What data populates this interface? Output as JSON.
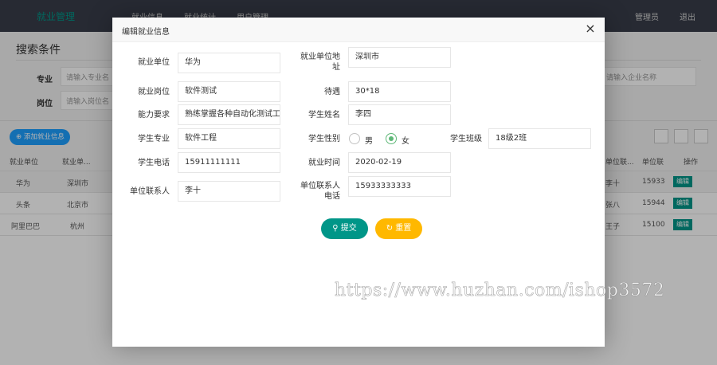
{
  "topbar": {
    "logo": "就业管理",
    "nav": [
      "就业信息",
      "就业统计",
      "用户管理"
    ],
    "admin": "管理员",
    "logout": "退出"
  },
  "search": {
    "title": "搜索条件",
    "major_label": "专业",
    "major_placeholder": "请输入专业名",
    "post_label": "岗位",
    "post_placeholder": "请输入岗位名",
    "company_placeholder": "请输入企业名称"
  },
  "toolbar": {
    "add_label": "添加就业信息"
  },
  "table": {
    "headers_left": [
      "就业单位",
      "就业单..."
    ],
    "headers_right": [
      "单位联...",
      "单位联",
      "操作"
    ],
    "rows": [
      {
        "company": "华为",
        "address": "深圳市",
        "contact": "李十",
        "phone": "15933",
        "action": "编辑"
      },
      {
        "company": "头条",
        "address": "北京市",
        "contact": "张八",
        "phone": "15944",
        "action": "编辑"
      },
      {
        "company": "阿里巴巴",
        "address": "杭州",
        "contact": "王子",
        "phone": "15100",
        "action": "编辑"
      }
    ]
  },
  "dialog": {
    "title": "编辑就业信息",
    "close_icon": "×",
    "fields": {
      "company_label": "就业单位",
      "company_value": "华为",
      "address_label": "就业单位地址",
      "address_value": "深圳市",
      "post_label": "就业岗位",
      "post_value": "软件测试",
      "salary_label": "待遇",
      "salary_value": "30*18",
      "ability_label": "能力要求",
      "ability_value": "熟练掌握各种自动化测试工具",
      "student_name_label": "学生姓名",
      "student_name_value": "李四",
      "major_label": "学生专业",
      "major_value": "软件工程",
      "gender_label": "学生性别",
      "gender_male": "男",
      "gender_female": "女",
      "gender_selected": "女",
      "class_label": "学生班级",
      "class_value": "18级2班",
      "phone_label": "学生电话",
      "phone_value": "15911111111",
      "date_label": "就业时间",
      "date_value": "2020-02-19",
      "contact_label": "单位联系人",
      "contact_value": "李十",
      "contact_phone_label": "单位联系人电话",
      "contact_phone_value": "15933333333"
    },
    "submit_label": "提交",
    "reset_label": "重置"
  },
  "watermark": "https://www.huzhan.com/ishop3572",
  "colors": {
    "topbar": "#393d49",
    "primary": "#009688",
    "accent_blue": "#1e9fff",
    "warning": "#ffb800",
    "radio_on": "#5fb878"
  }
}
